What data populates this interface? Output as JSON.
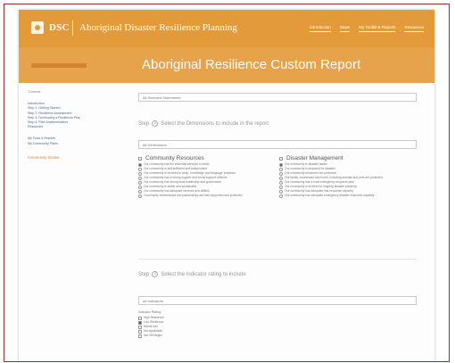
{
  "header": {
    "brand": "DSC",
    "app_title": "Aboriginal Disaster Resilience Planning",
    "nav": [
      "Introduction",
      "Steps",
      "My Toolkit & Reports",
      "Resources"
    ]
  },
  "page": {
    "title": "Aboriginal Resilience Custom Report"
  },
  "sidebar": {
    "heading": "Contents",
    "items": [
      "Introduction",
      "Step 1: Getting Started",
      "Step 2: Resilience Assessment",
      "Step 3: Developing a Resilience Plan",
      "Step 4: Plan Implementation",
      "Resources",
      "My Tools & Reports",
      "My Community Plans"
    ],
    "accent_item": "Community Stories"
  },
  "main": {
    "select_top": "All Selected Statements",
    "step1": {
      "number": "1",
      "text": "Select the Dimensions to include in the report"
    },
    "select_dimensions": "All Dimensions",
    "col_left": {
      "title": "Community Resources",
      "options": [
        "Our community has the essential services it needs",
        "Our community is self-sufficient and independent",
        "Our community is involved in deep, knowledge and language practices",
        "Our community has a strong support and social support network",
        "Our community has strong local leadership and governance",
        "Our community is stable and sustainable",
        "Our community has adequate services and utilities",
        "Community relationships and partnerships are well supported and protected"
      ]
    },
    "col_right": {
      "title": "Disaster Management",
      "options": [
        "Our community is disaster aware",
        "Our community is prepared for disaster",
        "Our community structures are protected",
        "Our family, businesses and home, including animals and pets are protected",
        "Our community has a local emergency response plan",
        "Our community is involved in ongoing disaster planning",
        "Our community has adequate first response capacity",
        "Our community has adequate emergency disaster response capacity"
      ]
    },
    "step2": {
      "number": "2",
      "text": "Select the Indicator rating to include"
    },
    "select_ratings": "All Indicators",
    "rating": {
      "label": "Indicator Rating",
      "options": [
        "High Resilience",
        "Low Resilience",
        "Needs Info",
        "Not Applicable",
        "Not Yet Begun"
      ],
      "checked_index": 1
    }
  }
}
